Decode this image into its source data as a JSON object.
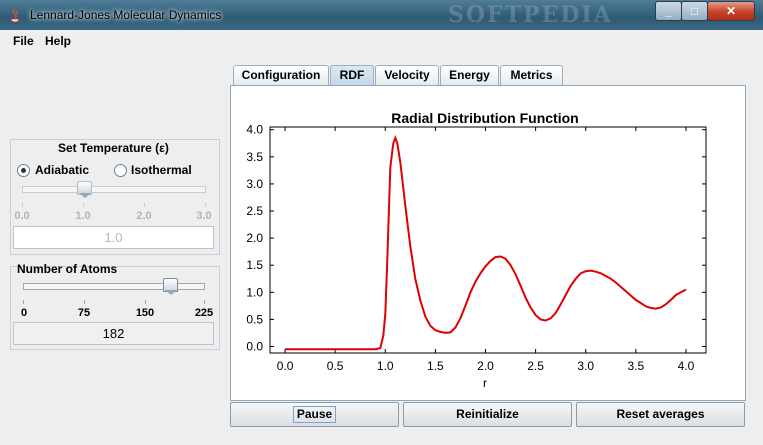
{
  "window": {
    "title": "Lennard-Jones Molecular Dynamics",
    "watermark": "SOFTPEDIA",
    "close_glyph": "✕",
    "max_glyph": "□",
    "min_glyph": "_"
  },
  "menu": {
    "items": [
      "File",
      "Help"
    ]
  },
  "temperature": {
    "title": "Set Temperature (ε)",
    "modes": [
      "Adiabatic",
      "Isothermal"
    ],
    "selected_mode": "Adiabatic",
    "slider": {
      "min": 0.0,
      "max": 3.0,
      "value": 1.0,
      "enabled": false
    },
    "tick_labels": [
      "0.0",
      "1.0",
      "2.0",
      "3.0"
    ],
    "value": "1.0"
  },
  "atoms": {
    "title": "Number of Atoms",
    "slider": {
      "min": 0,
      "max": 225,
      "value": 182,
      "enabled": true
    },
    "tick_labels": [
      "0",
      "75",
      "150",
      "225"
    ],
    "value": "182"
  },
  "tabs": [
    "Configuration",
    "RDF",
    "Velocity",
    "Energy",
    "Metrics"
  ],
  "active_tab": "RDF",
  "buttons": {
    "pause": "Pause",
    "reinitialize": "Reinitialize",
    "reset": "Reset averages"
  },
  "chart_data": {
    "type": "line",
    "title": "Radial Distribution Function",
    "xlabel": "r",
    "ylabel": "",
    "xlim": [
      -0.15,
      4.2
    ],
    "ylim": [
      -0.12,
      4.05
    ],
    "x_ticks": [
      "0.0",
      "0.5",
      "1.0",
      "1.5",
      "2.0",
      "2.5",
      "3.0",
      "3.5",
      "4.0"
    ],
    "y_ticks": [
      "0.0",
      "0.5",
      "1.0",
      "1.5",
      "2.0",
      "2.5",
      "3.0",
      "3.5",
      "4.0"
    ],
    "grid": false,
    "color": "#e00000",
    "series": [
      {
        "x": [
          0.0,
          0.5,
          0.9,
          0.95,
          0.98,
          1.0,
          1.02,
          1.05,
          1.08,
          1.1,
          1.12,
          1.15,
          1.2,
          1.25,
          1.3,
          1.35,
          1.4,
          1.45,
          1.5,
          1.55,
          1.6,
          1.65,
          1.7,
          1.75,
          1.8,
          1.85,
          1.9,
          1.95,
          2.0,
          2.05,
          2.1,
          2.15,
          2.2,
          2.25,
          2.3,
          2.35,
          2.4,
          2.45,
          2.5,
          2.55,
          2.6,
          2.65,
          2.7,
          2.75,
          2.8,
          2.85,
          2.9,
          2.95,
          3.0,
          3.05,
          3.1,
          3.15,
          3.2,
          3.25,
          3.3,
          3.35,
          3.4,
          3.45,
          3.5,
          3.55,
          3.6,
          3.65,
          3.7,
          3.75,
          3.8,
          3.85,
          3.9,
          3.95,
          4.0
        ],
        "y": [
          -0.05,
          -0.05,
          -0.05,
          -0.03,
          0.2,
          0.6,
          1.6,
          3.3,
          3.75,
          3.85,
          3.75,
          3.4,
          2.6,
          1.85,
          1.25,
          0.85,
          0.55,
          0.38,
          0.3,
          0.27,
          0.25,
          0.26,
          0.35,
          0.52,
          0.75,
          1.0,
          1.2,
          1.35,
          1.48,
          1.58,
          1.65,
          1.66,
          1.62,
          1.5,
          1.33,
          1.12,
          0.9,
          0.72,
          0.58,
          0.5,
          0.48,
          0.52,
          0.62,
          0.78,
          0.95,
          1.12,
          1.25,
          1.35,
          1.39,
          1.4,
          1.38,
          1.35,
          1.3,
          1.25,
          1.18,
          1.1,
          1.02,
          0.94,
          0.86,
          0.8,
          0.74,
          0.71,
          0.7,
          0.72,
          0.78,
          0.86,
          0.95,
          1.0,
          1.05
        ]
      }
    ]
  }
}
